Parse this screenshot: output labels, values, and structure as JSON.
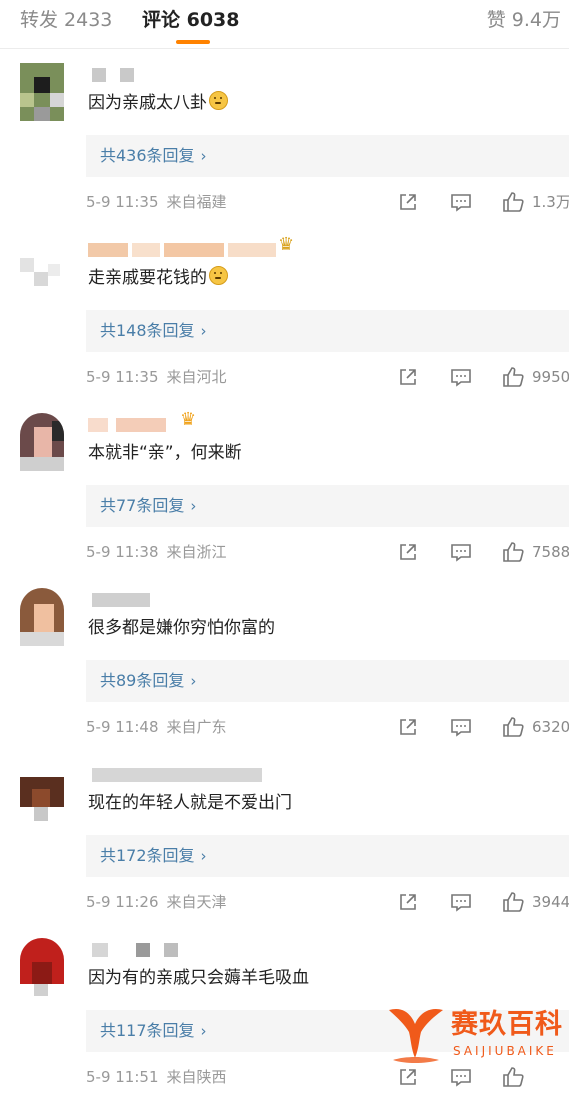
{
  "tabs": {
    "repost": "转发 2433",
    "comments": "评论 6038",
    "likes": "赞 9.4万",
    "accent_color": "#ff8200"
  },
  "icons": [
    "share-icon",
    "comment-icon",
    "thumbs-up-icon",
    "chevron-right-icon"
  ],
  "comments": [
    {
      "text": "因为亲戚太八卦",
      "replies": "共436条回复",
      "time": "5-9 11:35",
      "location": "来自福建",
      "likes": "1.3万"
    },
    {
      "text": "走亲戚要花钱的",
      "replies": "共148条回复",
      "time": "5-9 11:35",
      "location": "来自河北",
      "likes": "9950"
    },
    {
      "text": "本就非“亲”，何来断",
      "replies": "共77条回复",
      "time": "5-9 11:38",
      "location": "来自浙江",
      "likes": "7588"
    },
    {
      "text": "很多都是嫌你穷怕你富的",
      "replies": "共89条回复",
      "time": "5-9 11:48",
      "location": "来自广东",
      "likes": "6320"
    },
    {
      "text": "现在的年轻人就是不爱出门",
      "replies": "共172条回复",
      "time": "5-9 11:26",
      "location": "来自天津",
      "likes": "3944"
    },
    {
      "text": "因为有的亲戚只会薅羊毛吸血",
      "replies": "共117条回复",
      "time": "5-9 11:51",
      "location": "来自陕西",
      "likes": ""
    }
  ],
  "watermark": {
    "title": "赛玖百科",
    "subtitle": "SAIJIUBAIKE",
    "color": "#f05a1a"
  }
}
